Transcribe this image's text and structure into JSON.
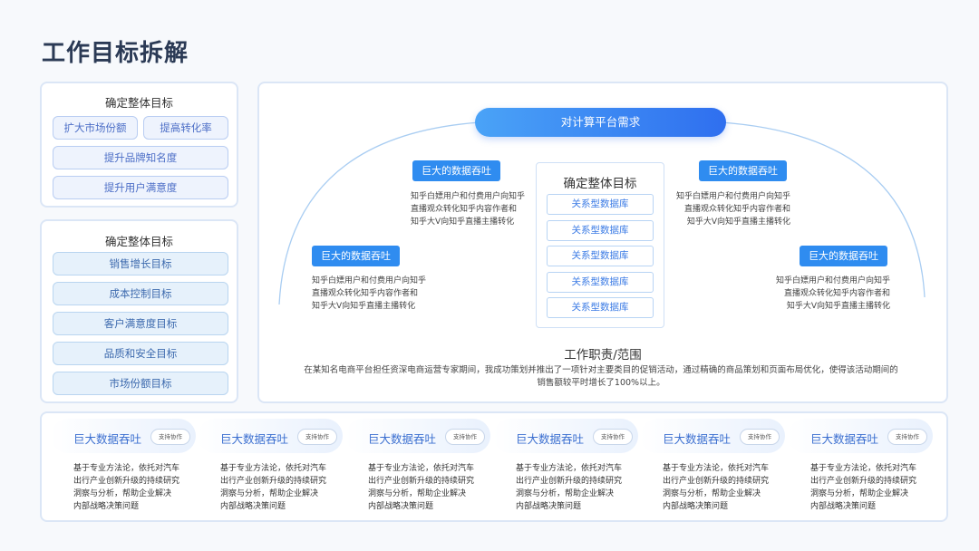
{
  "page": {
    "title": "工作目标拆解"
  },
  "goals_panel": {
    "title": "确定整体目标",
    "items": [
      "扩大市场份额",
      "提高转化率",
      "提升品牌知名度",
      "提升用户满意度"
    ]
  },
  "targets_panel": {
    "title": "确定整体目标",
    "items": [
      "销售增长目标",
      "成本控制目标",
      "客户满意度目标",
      "品质和安全目标",
      "市场份额目标"
    ]
  },
  "diagram": {
    "top_label": "对计算平台需求",
    "center_title": "确定整体目标",
    "center_items": [
      "关系型数据库",
      "关系型数据库",
      "关系型数据库",
      "关系型数据库",
      "关系型数据库"
    ],
    "tags": [
      {
        "label": "巨大的数据吞吐",
        "lines": [
          "知乎白嫖用户和付费用户向知乎",
          "直播观众转化知乎内容作者和",
          "知乎大V向知乎直播主播转化"
        ]
      },
      {
        "label": "巨大的数据吞吐",
        "lines": [
          "知乎白嫖用户和付费用户向知乎",
          "直播观众转化知乎内容作者和",
          "知乎大V向知乎直播主播转化"
        ]
      },
      {
        "label": "巨大的数据吞吐",
        "lines": [
          "知乎白嫖用户和付费用户向知乎",
          "直播观众转化知乎内容作者和",
          "知乎大V向知乎直播主播转化"
        ]
      },
      {
        "label": "巨大的数据吞吐",
        "lines": [
          "知乎白嫖用户和付费用户向知乎",
          "直播观众转化知乎内容作者和",
          "知乎大V向知乎直播主播转化"
        ]
      }
    ],
    "scope_title": "工作职责/范围",
    "scope_lines": [
      "在某知名电商平台担任资深电商运营专家期间，我成功策划并推出了一项针对主要类目的促销活动，通过精确的商品策划和页面布局优化，使得该活动期间的",
      "销售额较平时增长了100%以上。"
    ]
  },
  "cards": [
    {
      "name": "巨大数据吞吐",
      "badge": "支持协作",
      "lines": [
        "基于专业方法论，依托对汽车",
        "出行产业创新升级的持续研究",
        "洞察与分析，帮助企业解决",
        "内部战略决策问题"
      ]
    },
    {
      "name": "巨大数据吞吐",
      "badge": "支持协作",
      "lines": [
        "基于专业方法论，依托对汽车",
        "出行产业创新升级的持续研究",
        "洞察与分析，帮助企业解决",
        "内部战略决策问题"
      ]
    },
    {
      "name": "巨大数据吞吐",
      "badge": "支持协作",
      "lines": [
        "基于专业方法论，依托对汽车",
        "出行产业创新升级的持续研究",
        "洞察与分析，帮助企业解决",
        "内部战略决策问题"
      ]
    },
    {
      "name": "巨大数据吞吐",
      "badge": "支持协作",
      "lines": [
        "基于专业方法论，依托对汽车",
        "出行产业创新升级的持续研究",
        "洞察与分析，帮助企业解决",
        "内部战略决策问题"
      ]
    },
    {
      "name": "巨大数据吞吐",
      "badge": "支持协作",
      "lines": [
        "基于专业方法论，依托对汽车",
        "出行产业创新升级的持续研究",
        "洞察与分析，帮助企业解决",
        "内部战略决策问题"
      ]
    },
    {
      "name": "巨大数据吞吐",
      "badge": "支持协作",
      "lines": [
        "基于专业方法论，依托对汽车",
        "出行产业创新升级的持续研究",
        "洞察与分析，帮助企业解决",
        "内部战略决策问题"
      ]
    }
  ],
  "colors": {
    "accent": "#2f8cf0",
    "title": "#2b3a55",
    "panel_border": "#dbe6f6"
  }
}
